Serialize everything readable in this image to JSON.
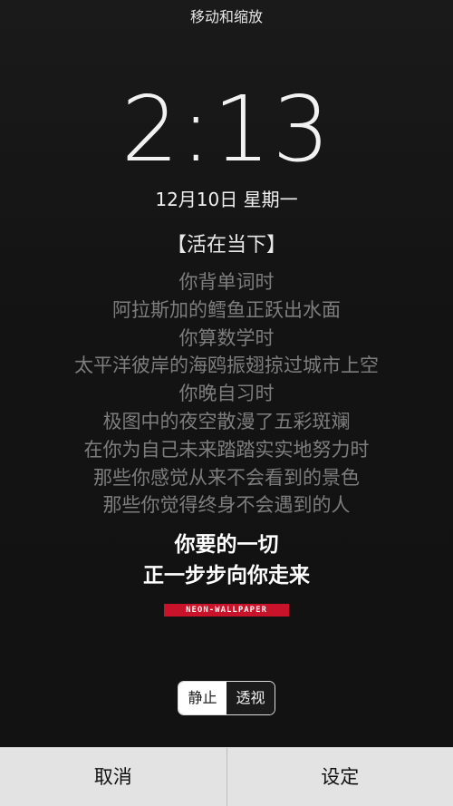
{
  "header": {
    "title": "移动和缩放"
  },
  "lockscreen": {
    "time": "2:13",
    "date": "12月10日 星期一"
  },
  "poem": {
    "title": "【活在当下】",
    "lines": [
      "你背单词时",
      "阿拉斯加的鳕鱼正跃出水面",
      "你算数学时",
      "太平洋彼岸的海鸥振翅掠过城市上空",
      "你晚自习时",
      "极图中的夜空散漫了五彩斑斓",
      "在你为自己未来踏踏实实地努力时",
      "那些你感觉从来不会看到的景色",
      "那些你觉得终身不会遇到的人"
    ],
    "emphasis": [
      "你要的一切",
      "正一步步向你走来"
    ],
    "watermark": "NEON-WALLPAPER"
  },
  "segmented": {
    "options": [
      "静止",
      "透视"
    ],
    "selected": "静止"
  },
  "actions": {
    "cancel": "取消",
    "confirm": "设定"
  },
  "colors": {
    "watermark_bg": "#c9132b",
    "bottom_bar": "#e3e3e3"
  }
}
